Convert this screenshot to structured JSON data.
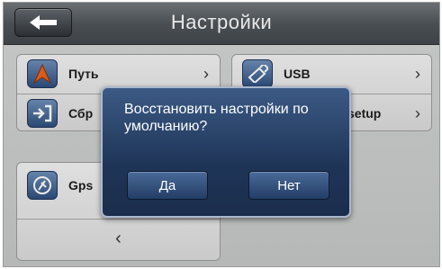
{
  "header": {
    "title": "Настройки",
    "back_icon": "arrow-left-icon"
  },
  "left_panel": {
    "items": [
      {
        "label": "Путь",
        "icon": "navigation-arrow-icon"
      },
      {
        "label": "Сбр",
        "icon": "exit-icon"
      }
    ]
  },
  "left_panel_2": {
    "items": [
      {
        "label": "Gps",
        "icon": "gps-satellite-icon"
      }
    ],
    "nav_prev": "‹"
  },
  "right_panel": {
    "items": [
      {
        "label": "USB",
        "icon": "usb-icon"
      },
      {
        "label": "setup",
        "icon": ""
      }
    ]
  },
  "chevron": "›",
  "dialog": {
    "message": "Восстановить настройки по умолчанию?",
    "yes_label": "Да",
    "no_label": "Нет"
  },
  "colors": {
    "titlebar": "#4a4f53",
    "dialog_bg": "#1f3558",
    "icon_tile": "#2f4f7f",
    "accent_arrow": "#e8641e"
  }
}
